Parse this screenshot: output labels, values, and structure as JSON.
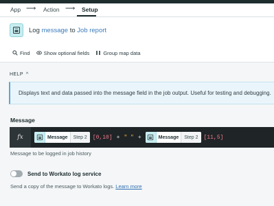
{
  "breadcrumbs": {
    "items": [
      "App",
      "Action",
      "Setup"
    ],
    "active": "Setup"
  },
  "header": {
    "prefix": "Log",
    "field": "message",
    "middle": "to",
    "target": "Job report"
  },
  "toolbar": {
    "find": "Find",
    "optional_fields": "Show optional fields",
    "group_map": "Group map data"
  },
  "help": {
    "label": "HELP",
    "text": "Displays text and data passed into the message field in the job output. Useful for testing and debugging."
  },
  "message_field": {
    "label": "Message",
    "fx": "fx",
    "pill1": {
      "name": "Message",
      "step": "Step 2"
    },
    "index1": "[0,10]",
    "op1": "+",
    "string_literal": "\" \"",
    "op2": "+",
    "pill2": {
      "name": "Message",
      "step": "Step 2"
    },
    "index2": "[11,5]",
    "hint": "Message to be logged in job history"
  },
  "workato_log": {
    "label": "Send to Workato log service",
    "enabled": false,
    "hint": "Send a copy of the message to Workato logs.",
    "link": "Learn more"
  }
}
